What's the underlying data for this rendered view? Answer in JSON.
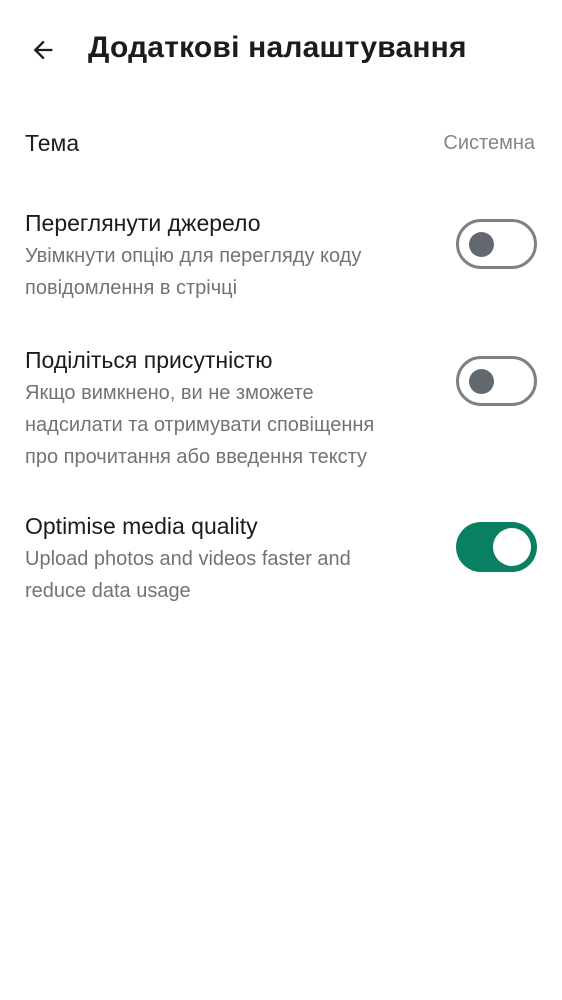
{
  "header": {
    "title": "Додаткові налаштування",
    "back_icon": "arrow-left-icon"
  },
  "settings": {
    "theme": {
      "title": "Тема",
      "value": "Системна"
    },
    "view_source": {
      "title": "Переглянути джерело",
      "subtitle_line1": "Увімкнути опцію для перегляду коду",
      "subtitle_line2": "повідомлення в стрічці",
      "enabled": false
    },
    "share_presence": {
      "title": "Поділіться присутністю",
      "subtitle_line1": "Якщо вимкнено, ви не зможете",
      "subtitle_line2": "надсилати та отримувати сповіщення",
      "subtitle_line3": "про прочитання або введення тексту",
      "enabled": false
    },
    "media_quality": {
      "title": "Optimise media quality",
      "subtitle_line1": "Upload photos and videos faster and",
      "subtitle_line2": "reduce data usage",
      "enabled": true
    }
  },
  "colors": {
    "accent": "#0b7f62",
    "toggle_off_border": "#7c8188",
    "secondary_text": "#6f7479"
  }
}
